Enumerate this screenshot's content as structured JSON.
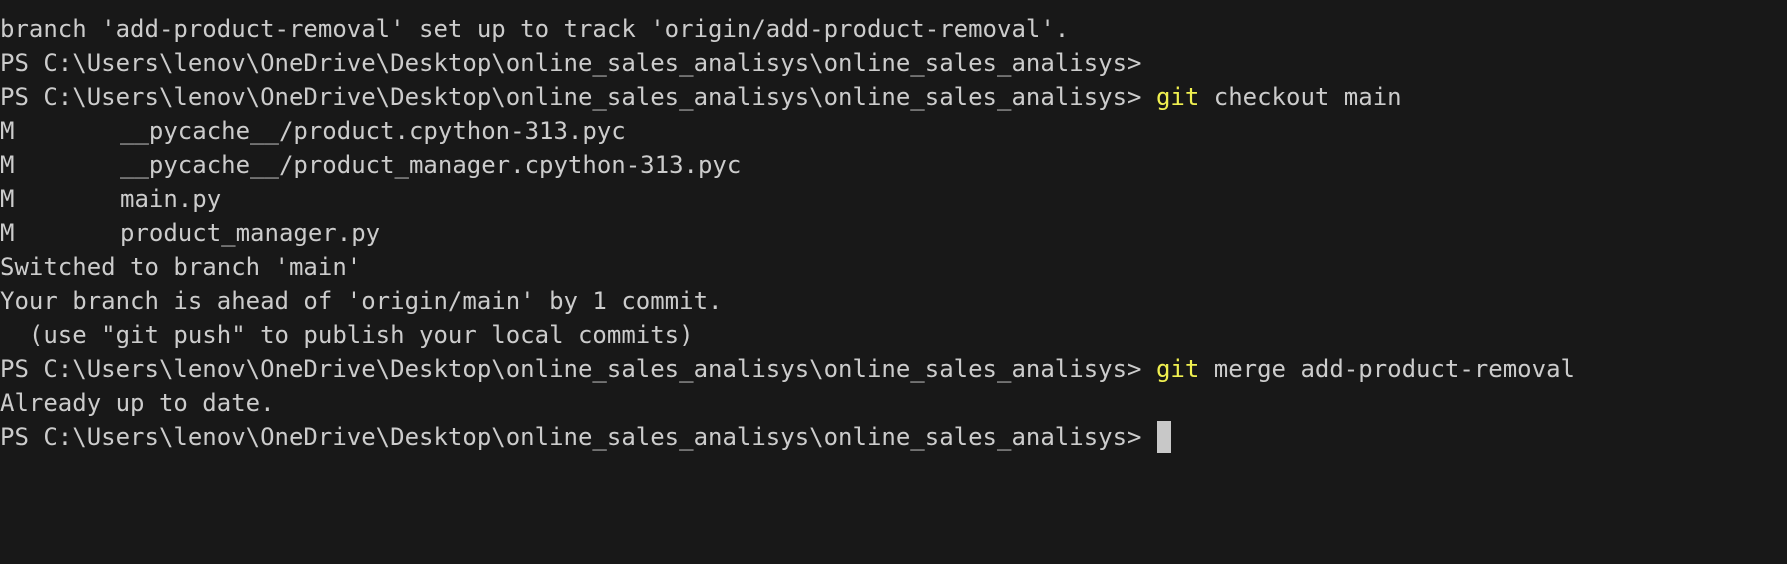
{
  "terminal": {
    "line1": "branch 'add-product-removal' set up to track 'origin/add-product-removal'.",
    "prompt": "PS C:\\Users\\lenov\\OneDrive\\Desktop\\online_sales_analisys\\online_sales_analisys> ",
    "cmd1": {
      "keyword": "git",
      "args": " checkout main"
    },
    "status_files": [
      {
        "code": "M",
        "path": "__pycache__/product.cpython-313.pyc"
      },
      {
        "code": "M",
        "path": "__pycache__/product_manager.cpython-313.pyc"
      },
      {
        "code": "M",
        "path": "main.py"
      },
      {
        "code": "M",
        "path": "product_manager.py"
      }
    ],
    "switched": "Switched to branch 'main'",
    "ahead": "Your branch is ahead of 'origin/main' by 1 commit.",
    "hint": "  (use \"git push\" to publish your local commits)",
    "cmd2": {
      "keyword": "git",
      "args": " merge add-product-removal"
    },
    "merge_result": "Already up to date."
  }
}
